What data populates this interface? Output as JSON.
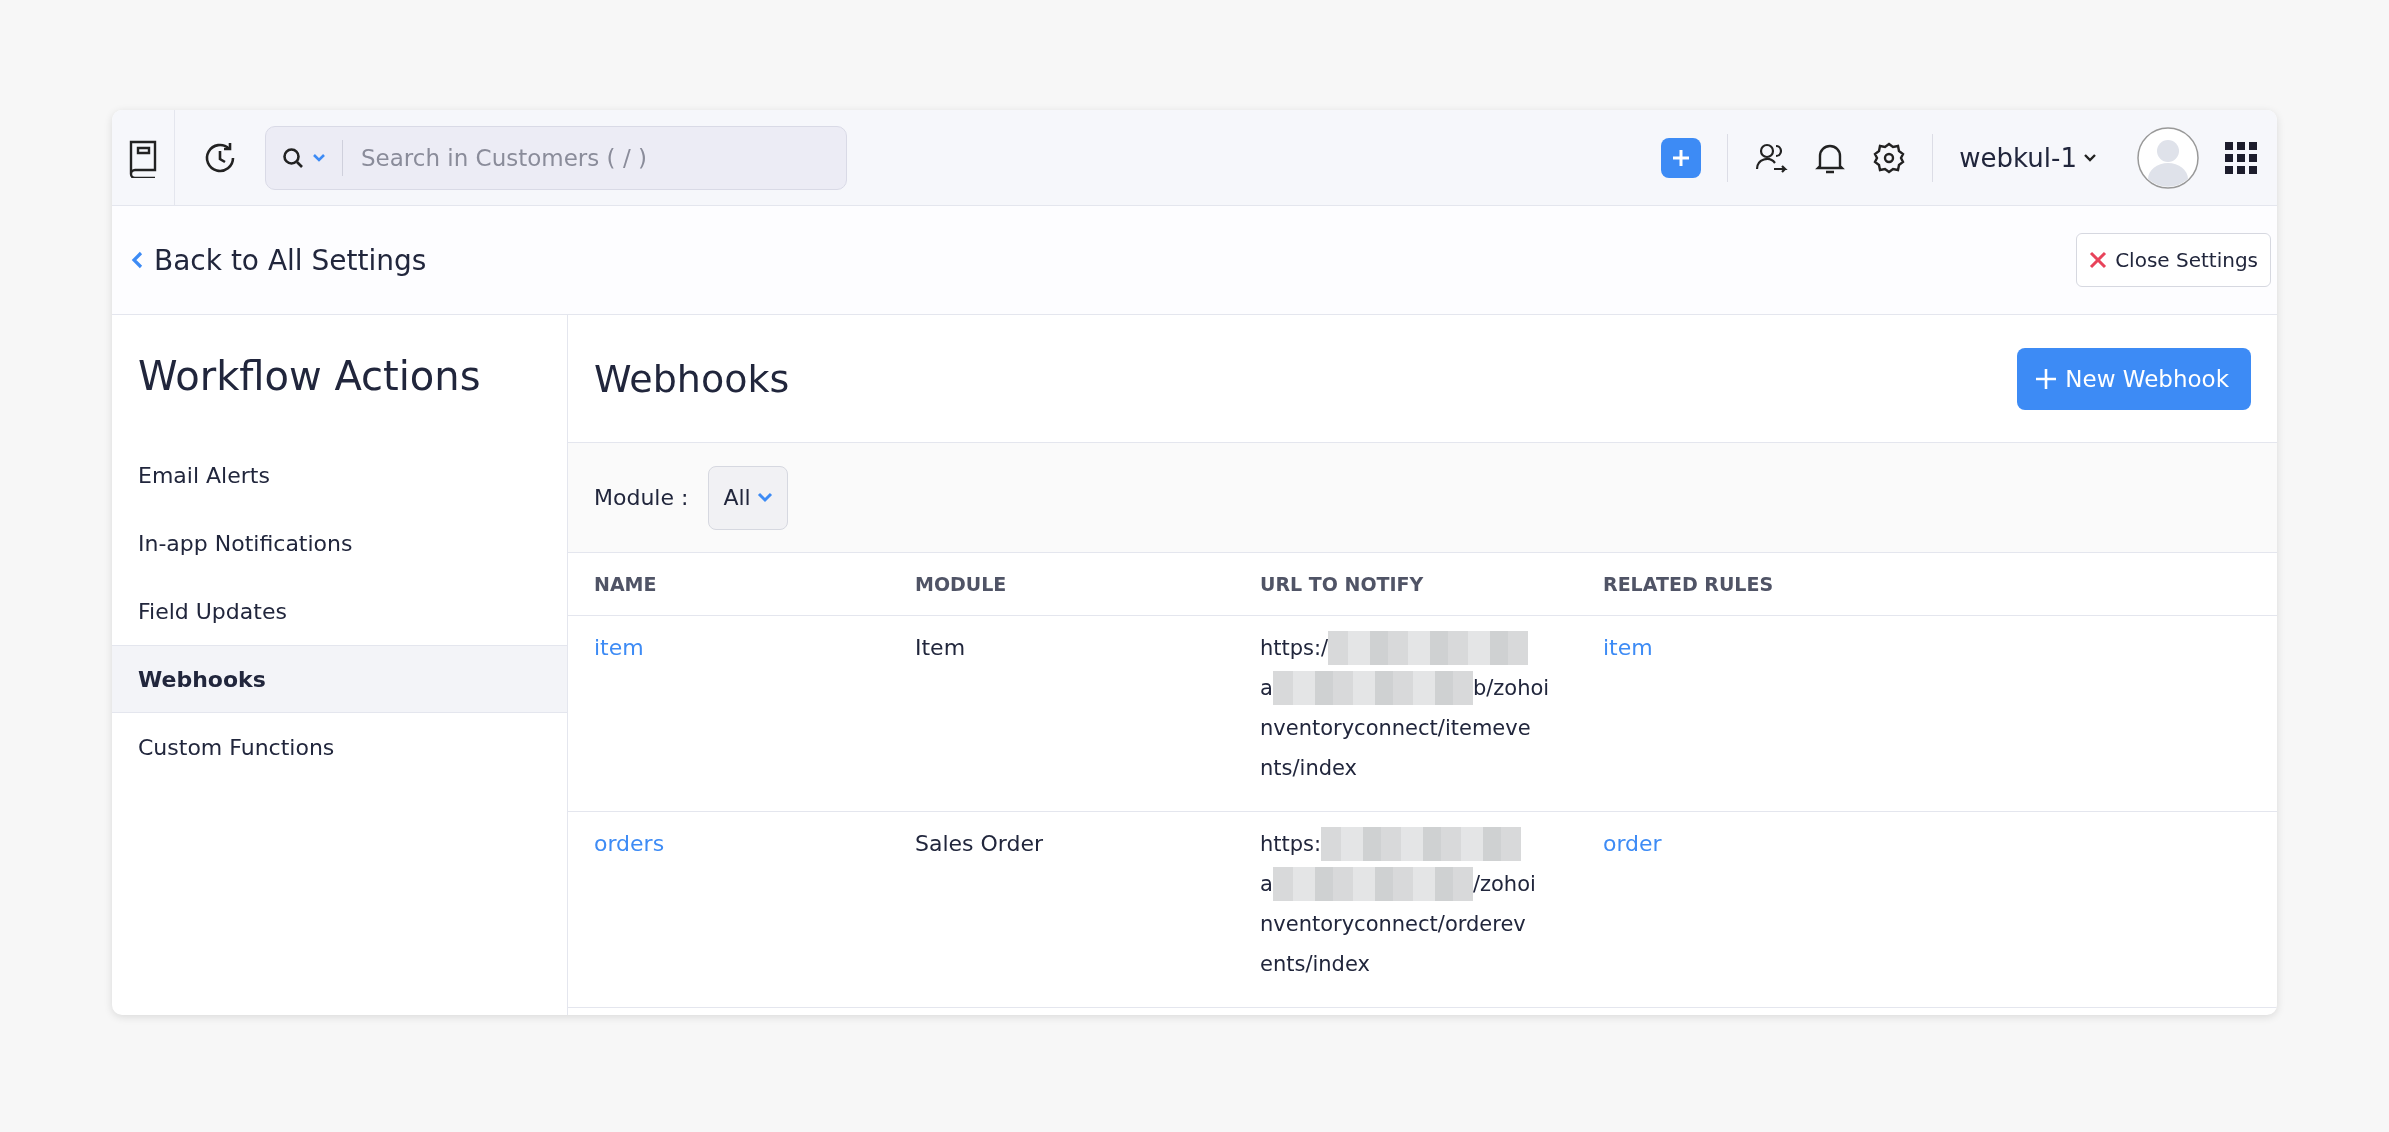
{
  "topbar": {
    "search": {
      "placeholder": "Search in Customers ( / )"
    },
    "org": "webkul-1"
  },
  "banner": {
    "back": "Back to All Settings",
    "close": "Close Settings"
  },
  "sidebar": {
    "title": "Workflow Actions",
    "items": [
      {
        "label": "Email Alerts",
        "selected": false
      },
      {
        "label": "In-app Notifications",
        "selected": false
      },
      {
        "label": "Field Updates",
        "selected": false
      },
      {
        "label": "Webhooks",
        "selected": true
      },
      {
        "label": "Custom Functions",
        "selected": false
      }
    ]
  },
  "main": {
    "title": "Webhooks",
    "new_button": "New Webhook",
    "filter": {
      "label": "Module :",
      "value": "All"
    },
    "table": {
      "columns": [
        "NAME",
        "MODULE",
        "URL TO NOTIFY",
        "RELATED RULES"
      ],
      "rows": [
        {
          "name": "item",
          "module": "Item",
          "url_lines": [
            [
              {
                "kind": "text",
                "text": "https:/"
              },
              {
                "kind": "redacted"
              }
            ],
            [
              {
                "kind": "text",
                "text": "a"
              },
              {
                "kind": "redacted"
              },
              {
                "kind": "text",
                "text": "b/zohoi"
              }
            ],
            [
              {
                "kind": "text",
                "text": "nventoryconnect/itemeve"
              }
            ],
            [
              {
                "kind": "text",
                "text": "nts/index"
              }
            ]
          ],
          "rule": "item"
        },
        {
          "name": "orders",
          "module": "Sales Order",
          "url_lines": [
            [
              {
                "kind": "text",
                "text": "https:"
              },
              {
                "kind": "redacted"
              }
            ],
            [
              {
                "kind": "text",
                "text": "a"
              },
              {
                "kind": "redacted"
              },
              {
                "kind": "text",
                "text": "/zohoi"
              }
            ],
            [
              {
                "kind": "text",
                "text": "nventoryconnect/orderev"
              }
            ],
            [
              {
                "kind": "text",
                "text": "ents/index"
              }
            ]
          ],
          "rule": "order"
        }
      ]
    }
  }
}
